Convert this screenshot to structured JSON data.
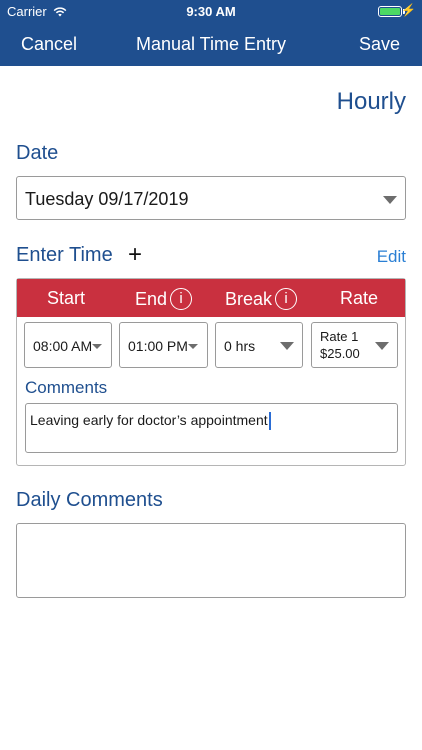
{
  "status_bar": {
    "carrier": "Carrier",
    "time": "9:30 AM",
    "battery_level": 1.0,
    "charging_icon": "bolt-icon"
  },
  "nav": {
    "cancel": "Cancel",
    "title": "Manual Time Entry",
    "save": "Save"
  },
  "pay_type": "Hourly",
  "date": {
    "label": "Date",
    "value": "Tuesday 09/17/2019"
  },
  "enter_time": {
    "label": "Enter Time",
    "add_icon": "plus-icon",
    "edit": "Edit",
    "columns": {
      "start": "Start",
      "end": "End",
      "break": "Break",
      "rate": "Rate"
    },
    "info_glyph": "i",
    "entry": {
      "start": "08:00 AM",
      "end": "01:00 PM",
      "break": "0 hrs",
      "rate_name": "Rate 1",
      "rate_amount": "$25.00"
    },
    "comments_label": "Comments",
    "comments_value": "Leaving early for doctor’s appointment"
  },
  "daily_comments": {
    "label": "Daily Comments",
    "value": ""
  },
  "colors": {
    "brand_blue": "#1f4f8f",
    "header_red": "#c9303f",
    "link_blue": "#2a7fd4"
  }
}
